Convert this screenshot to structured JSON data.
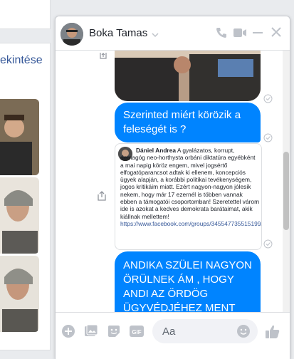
{
  "background": {
    "link_text": "ekintése"
  },
  "chat": {
    "contact_name": "Boka Tamas",
    "messages": {
      "bubble_1": "Szerinted miért körözik a feleségét is ?",
      "preview": {
        "author": "Dániel Andrea",
        "text": "A gyalázatos, korrupt, demagóg neo-horthysta orbáni diktatúra egyébként a mai napig köröz engem, mivel jogsértő elfogatóparancsot adtak ki ellenem, koncepciós ügyek alapján, a korábbi politikai tevékenységem, jogos kritikáim miatt. Ezért nagyon-nagyon jólesik nekem, hogy már 17 ezernél is többen vannak ebben a támogatói csoportomban! Szeretettel várom ide is azokat a kedves demokrata barátaimat, akik kiállnak mellettem!",
        "link": "https://www.facebook.com/groups/345547735515199/"
      },
      "bubble_2": "ANDIKA  SZÜLEI NAGYON ÖRÜLNEK ÁM , HOGY ANDI AZ ÖRDÖG ÜGYVÉDJÉHEZ MENT"
    },
    "composer": {
      "placeholder": "Aa"
    },
    "colors": {
      "accent": "#0084ff",
      "icon_gray": "#bec2c9"
    }
  }
}
